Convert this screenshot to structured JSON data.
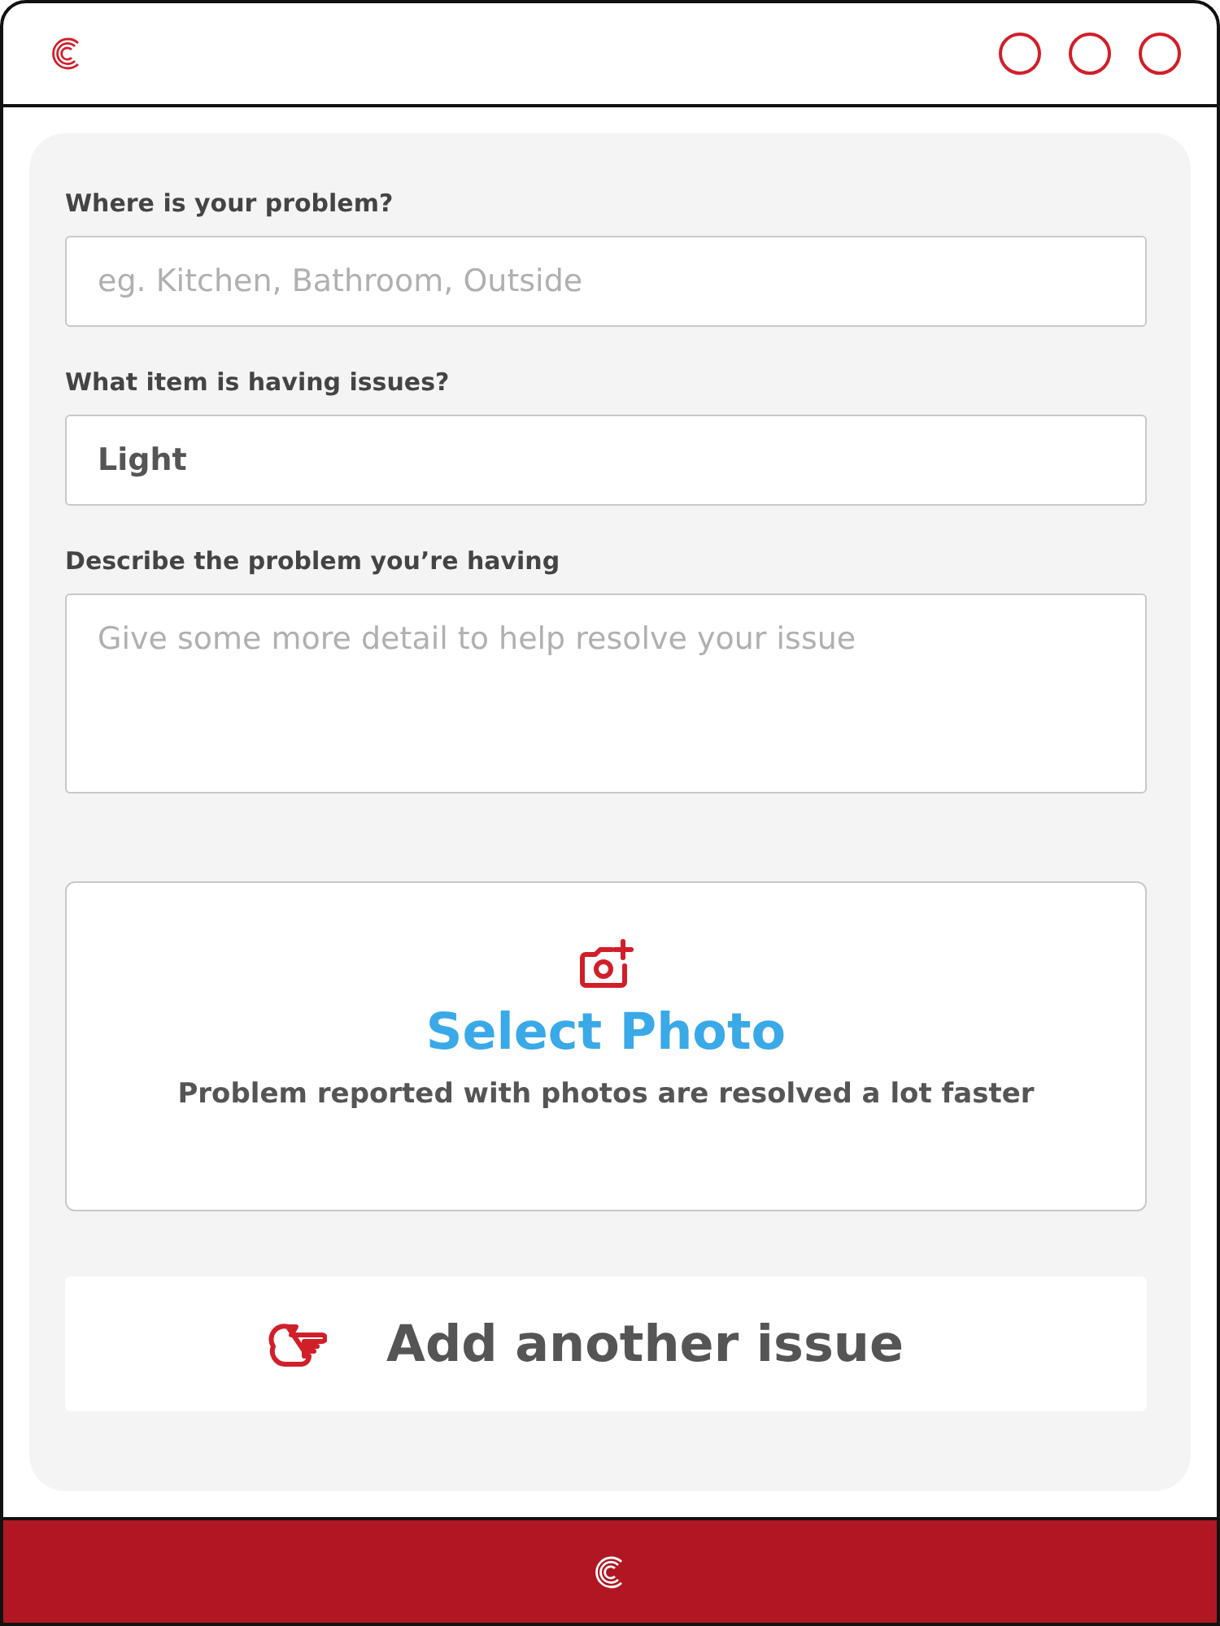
{
  "fields": [
    {
      "label": "Where is your problem?",
      "kind": "input",
      "placeholder": "eg. Kitchen, Bathroom, Outside"
    },
    {
      "label": "What item is having issues?",
      "kind": "input",
      "value": "Light"
    },
    {
      "label": "Describe the problem you’re having",
      "kind": "textarea",
      "placeholder": "Give some more detail to help resolve your issue"
    }
  ],
  "photo": {
    "title": "Select Photo",
    "hint": "Problem reported with photos are resolved a lot faster"
  },
  "add_button": {
    "label": "Add another issue"
  }
}
